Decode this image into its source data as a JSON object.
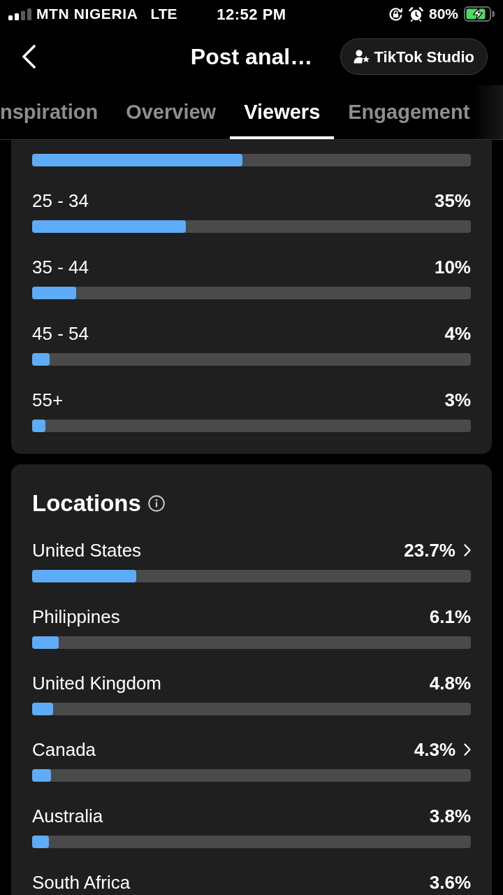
{
  "status_bar": {
    "carrier": "MTN NIGERIA",
    "network": "LTE",
    "time": "12:52 PM",
    "battery": "80%",
    "charging": true
  },
  "header": {
    "title": "Post anal…",
    "studio_button": "TikTok Studio"
  },
  "tabs": [
    {
      "label": "nspiration",
      "selected": false
    },
    {
      "label": "Overview",
      "selected": false
    },
    {
      "label": "Viewers",
      "selected": true
    },
    {
      "label": "Engagement",
      "selected": false
    }
  ],
  "age_card": {
    "rows": [
      {
        "level": 0.48
      },
      {
        "label": "25 - 34",
        "value": "35%",
        "level": 0.35
      },
      {
        "label": "35 - 44",
        "value": "10%",
        "level": 0.1
      },
      {
        "label": "45 - 54",
        "value": "4%",
        "level": 0.04
      },
      {
        "label": "55+",
        "value": "3%",
        "level": 0.03
      }
    ]
  },
  "locations": {
    "title": "Locations",
    "rows": [
      {
        "label": "United States",
        "value": "23.7%",
        "level": 0.237,
        "has_details": true
      },
      {
        "label": "Philippines",
        "value": "6.1%",
        "level": 0.061,
        "has_details": false
      },
      {
        "label": "United Kingdom",
        "value": "4.8%",
        "level": 0.048,
        "has_details": false
      },
      {
        "label": "Canada",
        "value": "4.3%",
        "level": 0.043,
        "has_details": true
      },
      {
        "label": "Australia",
        "value": "3.8%",
        "level": 0.038,
        "has_details": false
      },
      {
        "label": "South Africa",
        "value": "3.6%",
        "has_details": false
      }
    ]
  }
}
